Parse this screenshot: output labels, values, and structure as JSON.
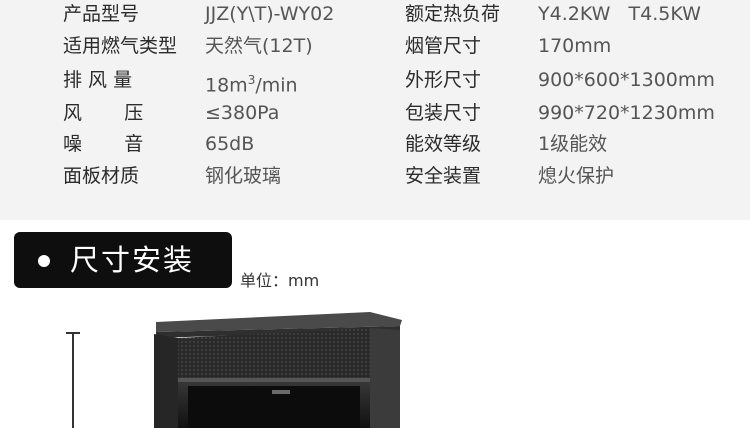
{
  "specs": [
    {
      "k1": "产品型号",
      "v1": "JJZ(Y\\T)-WY02",
      "k2": "额定热负荷",
      "v2": "Y4.2KW   T4.5KW"
    },
    {
      "k1": "适用燃气类型",
      "v1": "天然气(12T)",
      "k2": "烟管尺寸",
      "v2": "170mm"
    },
    {
      "k1": "排 风 量",
      "v1_pre": "18m",
      "v1_sup": "3",
      "v1_post": "/min",
      "k2": "外形尺寸",
      "v2": "900*600*1300mm"
    },
    {
      "k1": "风       压",
      "v1": "≤380Pa",
      "k2": "包装尺寸",
      "v2": "990*720*1230mm"
    },
    {
      "k1": "噪       音",
      "v1": "65dB",
      "k2": "能效等级",
      "v2": "1级能效"
    },
    {
      "k1": "面板材质",
      "v1": "钢化玻璃",
      "k2": "安全装置",
      "v2": "熄火保护"
    }
  ],
  "section": {
    "title": "尺寸安装",
    "unit_label": "单位：mm"
  },
  "colors": {
    "panel_bg": "#f3f3f3",
    "pill_bg": "#0e0e0e",
    "appliance_dark": "#1c1c1c"
  }
}
